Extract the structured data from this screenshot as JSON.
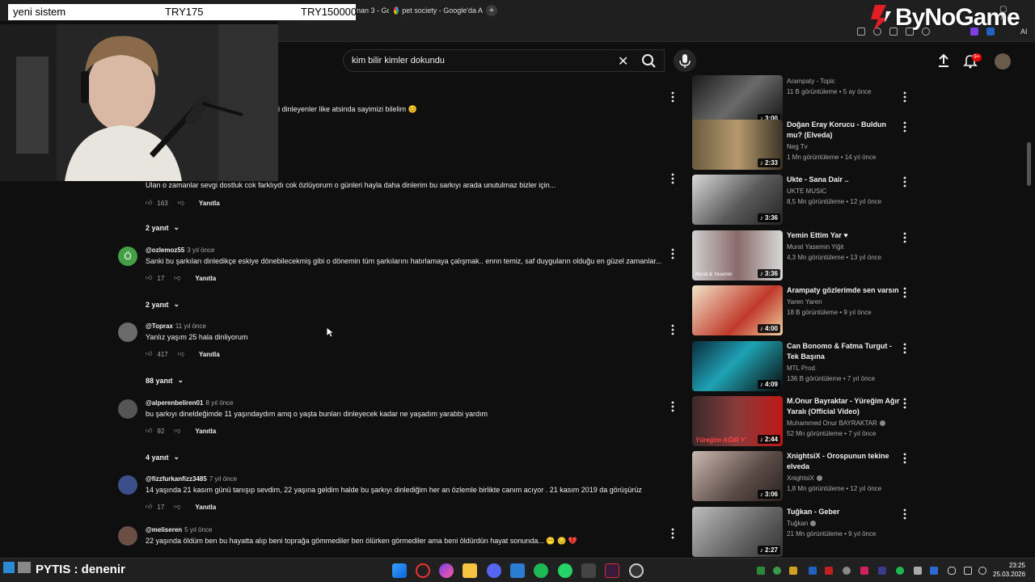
{
  "browser": {
    "tabs": [
      {
        "label": "nan 3 - Go"
      },
      {
        "label": "pet society - Google'da A"
      }
    ]
  },
  "overlay": {
    "name": "yeni sistem",
    "price1": "TRY175",
    "price2": "TRY150000"
  },
  "logo": {
    "text": "ByNoGame"
  },
  "toolbar": {
    "ai_label": "AI"
  },
  "search": {
    "query": "kim bilir kimler dokundu"
  },
  "header": {
    "notif_count": "9+"
  },
  "partial_comment": {
    "text": "i dinleyenler like atsinda sayimizi bilelim 😊"
  },
  "comments": [
    {
      "author": "",
      "time": "",
      "text": "Ulan o zamanlar sevgi dostluk cok farklıydı cok özlüyorum o günleri hayla daha dinlerim bu sarkıyı arada unutulmaz bizler için...",
      "likes": "163",
      "reply": "Yanıtla",
      "replies": "2 yanıt"
    },
    {
      "author": "@ozlemoz55",
      "time": "3 yıl önce",
      "avatar_letter": "Ö",
      "text": "Sanki bu şarkıları dinledikçe eskiye dönebilecekmiş gibi o dönemin tüm şarkılarını hatırlamaya çalışmak.. ennn temiz, saf duyguların olduğu en güzel zamanlar...",
      "likes": "17",
      "reply": "Yanıtla",
      "replies": "2 yanıt"
    },
    {
      "author": "@Toprax",
      "time": "11 yıl önce",
      "text": "Yanlız yaşım 25 hala dinliyorum",
      "likes": "417",
      "reply": "Yanıtla",
      "replies": "88 yanıt"
    },
    {
      "author": "@alperenbeliren01",
      "time": "8 yıl önce",
      "text": "bu şarkıyı dineldeğimde 11 yaşındaydım amq o yaşta bunları dinleyecek kadar ne yaşadım yarabbi yardım",
      "likes": "92",
      "reply": "Yanıtla",
      "replies": "4 yanıt"
    },
    {
      "author": "@fizzfurkanfizz3485",
      "time": "7 yıl önce",
      "text": "14 yaşında 21 kasım günü tanışıp sevdim, 22 yaşına geldim halde bu şarkıyı dinlediğim her an özlemle birlikte canım acıyor . 21 kasım 2019 da görüşürüz",
      "likes": "17",
      "reply": "Yanıtla"
    },
    {
      "author": "@meliseren",
      "time": "5 yıl önce",
      "text": "22 yaşında öldüm ben bu hayatta alıp beni toprağa gömmediler ben ölürken görmediler ama beni öldürdün hayat sonunda... 😶 😔 💔"
    }
  ],
  "sidebar": [
    {
      "title": "",
      "channel": "Arampaty - Topic",
      "meta": "11 B görüntüleme • 5 ay önce",
      "duration": "3:00",
      "verified": false
    },
    {
      "title": "Doğan Eray Korucu - Buldun mu? (Elveda)",
      "channel": "Neg Tv",
      "meta": "1 Mn görüntüleme • 14 yıl önce",
      "duration": "2:33",
      "verified": false
    },
    {
      "title": "Ukte - Sana Dair ..",
      "channel": "UKTE MUSIC",
      "meta": "8,5 Mn görüntüleme • 12 yıl önce",
      "duration": "3:36",
      "verified": false
    },
    {
      "title": "Yemin Ettim Yar ♥",
      "channel": "Murat Yasemin Yiğit",
      "meta": "4,3 Mn görüntüleme • 13 yıl önce",
      "duration": "3:36",
      "verified": false,
      "thumb_caption": "Murat & Yasemin"
    },
    {
      "title": "Arampaty gözlerimde sen varsın",
      "channel": "Yaren Yaren",
      "meta": "18 B görüntüleme • 9 yıl önce",
      "duration": "4:00",
      "verified": false
    },
    {
      "title": "Can Bonomo & Fatma Turgut - Tek Başına",
      "channel": "MTL Prod.",
      "meta": "136 B görüntüleme • 7 yıl önce",
      "duration": "4:09",
      "verified": false
    },
    {
      "title": "M.Onur Bayraktar - Yüreğim Ağır Yaralı (Official Video)",
      "channel": "Muhammed Onur BAYRAKTAR",
      "meta": "52 Mn görüntüleme • 7 yıl önce",
      "duration": "2:44",
      "verified": true,
      "thumb_caption": "Yüreğim AĞIR Y"
    },
    {
      "title": "XnightsiX - Orospunun tekine elveda",
      "channel": "XnightsiX",
      "meta": "1,8 Mn görüntüleme • 12 yıl önce",
      "duration": "3:06",
      "verified": true
    },
    {
      "title": "Tuğkan - Geber",
      "channel": "Tuğkan",
      "meta": "21 Mn görüntüleme • 9 yıl önce",
      "duration": "2:27",
      "verified": true
    }
  ],
  "taskbar": {
    "stream_text": "PYTIS : denenir",
    "time": "23:25",
    "date": "25.03.2026"
  },
  "colors": {
    "bg": "#0f0f0f",
    "accent_red": "#ff0000",
    "text": "#f1f1f1",
    "muted": "#aaaaaa"
  }
}
